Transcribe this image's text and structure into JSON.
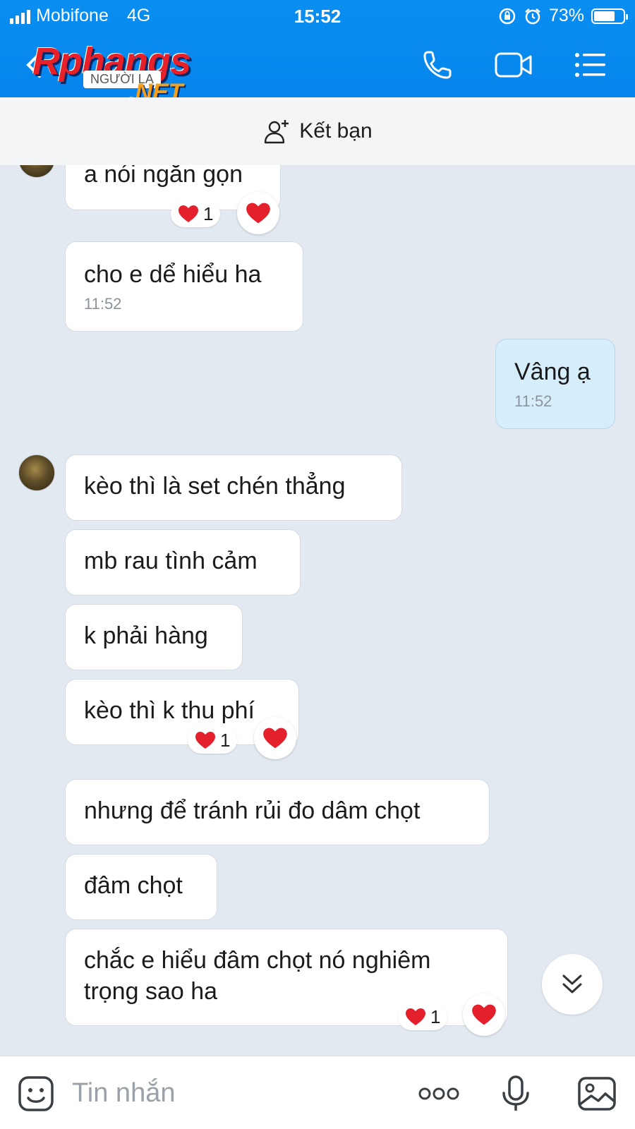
{
  "status_bar": {
    "carrier": "Mobifone",
    "network": "4G",
    "time": "15:52",
    "battery": "73%",
    "battery_level": 0.73
  },
  "header": {
    "logo_main": "Rphang",
    "logo_s": "s",
    "logo_sub": "NGƯỜI LẠ",
    "logo_net": ".NET",
    "accent_color": "#0a8ef0"
  },
  "friend_bar": {
    "label": "Kết bạn"
  },
  "messages": [
    {
      "text": "a nói ngắn gọn",
      "reaction_count": "1"
    },
    {
      "text": "cho e dể hiểu ha",
      "time": "11:52"
    },
    {
      "text": "Vâng ạ",
      "time": "11:52"
    },
    {
      "text": "kèo thì là set chén thẳng"
    },
    {
      "text": "mb rau tình cảm"
    },
    {
      "text": "k phải hàng"
    },
    {
      "text": "kèo thì k thu phí",
      "reaction_count": "1"
    },
    {
      "text": "nhưng để tránh rủi đo dâm chọt"
    },
    {
      "text": "đâm chọt"
    },
    {
      "text_line1": "chắc e hiểu đâm chọt nó nghiêm",
      "text_line2": "trọng sao ha",
      "reaction_count": "1"
    }
  ],
  "input_bar": {
    "placeholder": "Tin nhắn"
  }
}
